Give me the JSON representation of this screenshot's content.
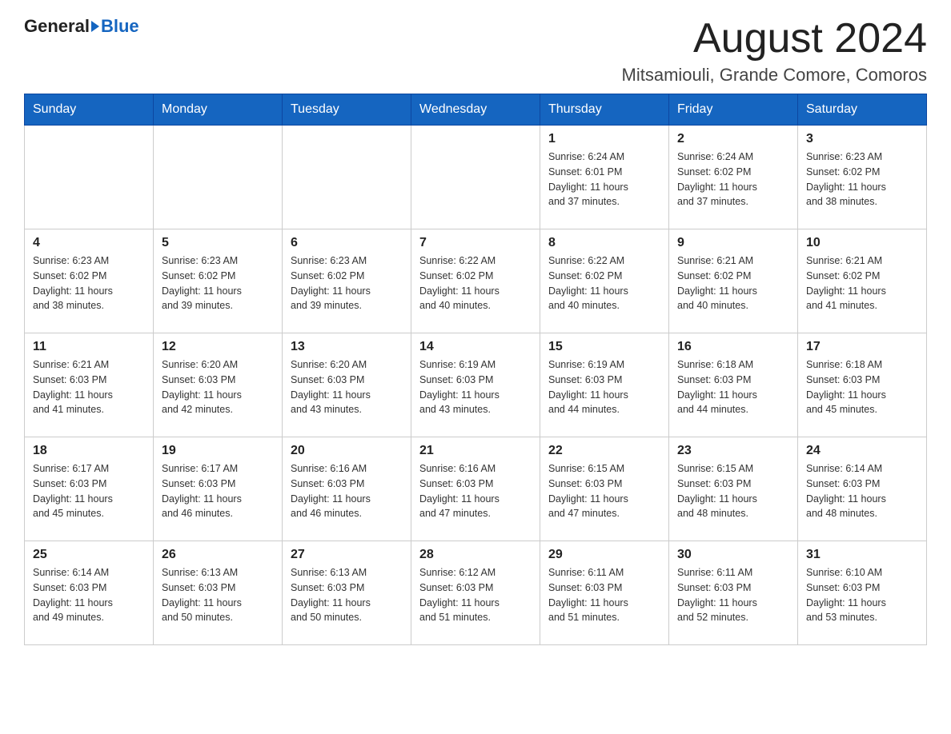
{
  "header": {
    "logo_general": "General",
    "logo_blue": "Blue",
    "title": "August 2024",
    "subtitle": "Mitsamiouli, Grande Comore, Comoros"
  },
  "days_of_week": [
    "Sunday",
    "Monday",
    "Tuesday",
    "Wednesday",
    "Thursday",
    "Friday",
    "Saturday"
  ],
  "weeks": [
    [
      {
        "day": "",
        "info": ""
      },
      {
        "day": "",
        "info": ""
      },
      {
        "day": "",
        "info": ""
      },
      {
        "day": "",
        "info": ""
      },
      {
        "day": "1",
        "info": "Sunrise: 6:24 AM\nSunset: 6:01 PM\nDaylight: 11 hours\nand 37 minutes."
      },
      {
        "day": "2",
        "info": "Sunrise: 6:24 AM\nSunset: 6:02 PM\nDaylight: 11 hours\nand 37 minutes."
      },
      {
        "day": "3",
        "info": "Sunrise: 6:23 AM\nSunset: 6:02 PM\nDaylight: 11 hours\nand 38 minutes."
      }
    ],
    [
      {
        "day": "4",
        "info": "Sunrise: 6:23 AM\nSunset: 6:02 PM\nDaylight: 11 hours\nand 38 minutes."
      },
      {
        "day": "5",
        "info": "Sunrise: 6:23 AM\nSunset: 6:02 PM\nDaylight: 11 hours\nand 39 minutes."
      },
      {
        "day": "6",
        "info": "Sunrise: 6:23 AM\nSunset: 6:02 PM\nDaylight: 11 hours\nand 39 minutes."
      },
      {
        "day": "7",
        "info": "Sunrise: 6:22 AM\nSunset: 6:02 PM\nDaylight: 11 hours\nand 40 minutes."
      },
      {
        "day": "8",
        "info": "Sunrise: 6:22 AM\nSunset: 6:02 PM\nDaylight: 11 hours\nand 40 minutes."
      },
      {
        "day": "9",
        "info": "Sunrise: 6:21 AM\nSunset: 6:02 PM\nDaylight: 11 hours\nand 40 minutes."
      },
      {
        "day": "10",
        "info": "Sunrise: 6:21 AM\nSunset: 6:02 PM\nDaylight: 11 hours\nand 41 minutes."
      }
    ],
    [
      {
        "day": "11",
        "info": "Sunrise: 6:21 AM\nSunset: 6:03 PM\nDaylight: 11 hours\nand 41 minutes."
      },
      {
        "day": "12",
        "info": "Sunrise: 6:20 AM\nSunset: 6:03 PM\nDaylight: 11 hours\nand 42 minutes."
      },
      {
        "day": "13",
        "info": "Sunrise: 6:20 AM\nSunset: 6:03 PM\nDaylight: 11 hours\nand 43 minutes."
      },
      {
        "day": "14",
        "info": "Sunrise: 6:19 AM\nSunset: 6:03 PM\nDaylight: 11 hours\nand 43 minutes."
      },
      {
        "day": "15",
        "info": "Sunrise: 6:19 AM\nSunset: 6:03 PM\nDaylight: 11 hours\nand 44 minutes."
      },
      {
        "day": "16",
        "info": "Sunrise: 6:18 AM\nSunset: 6:03 PM\nDaylight: 11 hours\nand 44 minutes."
      },
      {
        "day": "17",
        "info": "Sunrise: 6:18 AM\nSunset: 6:03 PM\nDaylight: 11 hours\nand 45 minutes."
      }
    ],
    [
      {
        "day": "18",
        "info": "Sunrise: 6:17 AM\nSunset: 6:03 PM\nDaylight: 11 hours\nand 45 minutes."
      },
      {
        "day": "19",
        "info": "Sunrise: 6:17 AM\nSunset: 6:03 PM\nDaylight: 11 hours\nand 46 minutes."
      },
      {
        "day": "20",
        "info": "Sunrise: 6:16 AM\nSunset: 6:03 PM\nDaylight: 11 hours\nand 46 minutes."
      },
      {
        "day": "21",
        "info": "Sunrise: 6:16 AM\nSunset: 6:03 PM\nDaylight: 11 hours\nand 47 minutes."
      },
      {
        "day": "22",
        "info": "Sunrise: 6:15 AM\nSunset: 6:03 PM\nDaylight: 11 hours\nand 47 minutes."
      },
      {
        "day": "23",
        "info": "Sunrise: 6:15 AM\nSunset: 6:03 PM\nDaylight: 11 hours\nand 48 minutes."
      },
      {
        "day": "24",
        "info": "Sunrise: 6:14 AM\nSunset: 6:03 PM\nDaylight: 11 hours\nand 48 minutes."
      }
    ],
    [
      {
        "day": "25",
        "info": "Sunrise: 6:14 AM\nSunset: 6:03 PM\nDaylight: 11 hours\nand 49 minutes."
      },
      {
        "day": "26",
        "info": "Sunrise: 6:13 AM\nSunset: 6:03 PM\nDaylight: 11 hours\nand 50 minutes."
      },
      {
        "day": "27",
        "info": "Sunrise: 6:13 AM\nSunset: 6:03 PM\nDaylight: 11 hours\nand 50 minutes."
      },
      {
        "day": "28",
        "info": "Sunrise: 6:12 AM\nSunset: 6:03 PM\nDaylight: 11 hours\nand 51 minutes."
      },
      {
        "day": "29",
        "info": "Sunrise: 6:11 AM\nSunset: 6:03 PM\nDaylight: 11 hours\nand 51 minutes."
      },
      {
        "day": "30",
        "info": "Sunrise: 6:11 AM\nSunset: 6:03 PM\nDaylight: 11 hours\nand 52 minutes."
      },
      {
        "day": "31",
        "info": "Sunrise: 6:10 AM\nSunset: 6:03 PM\nDaylight: 11 hours\nand 53 minutes."
      }
    ]
  ]
}
